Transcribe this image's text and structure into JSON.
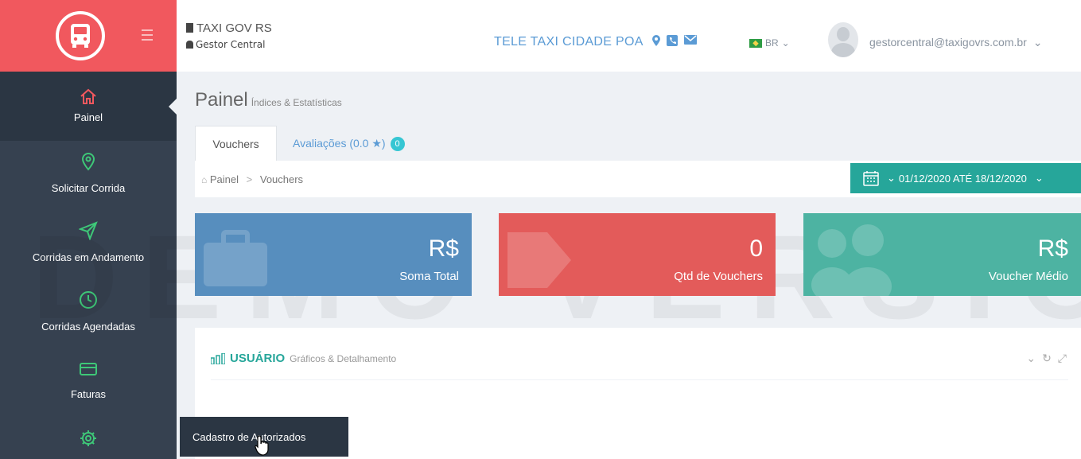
{
  "header": {
    "app_title": "TAXI GOV RS",
    "app_subtitle": "Gestor Central",
    "contact_name": "TELE TAXI CIDADE POA",
    "language": "BR",
    "user_email": "gestorcentral@taxigovrs.com.br"
  },
  "sidebar": {
    "items": [
      {
        "label": "Painel",
        "icon": "home-icon"
      },
      {
        "label": "Solicitar Corrida",
        "icon": "map-pin-icon"
      },
      {
        "label": "Corridas em Andamento",
        "icon": "send-icon"
      },
      {
        "label": "Corridas Agendadas",
        "icon": "clock-icon"
      },
      {
        "label": "Faturas",
        "icon": "credit-card-icon"
      },
      {
        "label": "",
        "icon": "gear-icon"
      }
    ],
    "submenu_label": "Cadastro de Autorizados"
  },
  "page": {
    "title": "Painel",
    "subtitle": "Índices & Estatísticas"
  },
  "tabs": [
    {
      "label": "Vouchers"
    },
    {
      "label": "Avaliações (0.0 ★)",
      "badge": "0"
    }
  ],
  "breadcrumb": {
    "home": "Painel",
    "separator": ">",
    "current": "Vouchers"
  },
  "date_range": "01/12/2020 ATÉ 18/12/2020",
  "stats": [
    {
      "value": "R$",
      "label": "Soma Total",
      "color": "#578ebe"
    },
    {
      "value": "0",
      "label": "Qtd de Vouchers",
      "color": "#e35b5a"
    },
    {
      "value": "R$",
      "label": "Voucher Médio",
      "color": "#4db3a2"
    }
  ],
  "portlet": {
    "title": "USUÁRIO",
    "subtitle": "Gráficos & Detalhamento"
  },
  "watermark": "DEMO VERSION",
  "colors": {
    "brand": "#f1585e",
    "sidebar": "#364150",
    "accent": "#26a69a",
    "link": "#5b9bd5"
  }
}
